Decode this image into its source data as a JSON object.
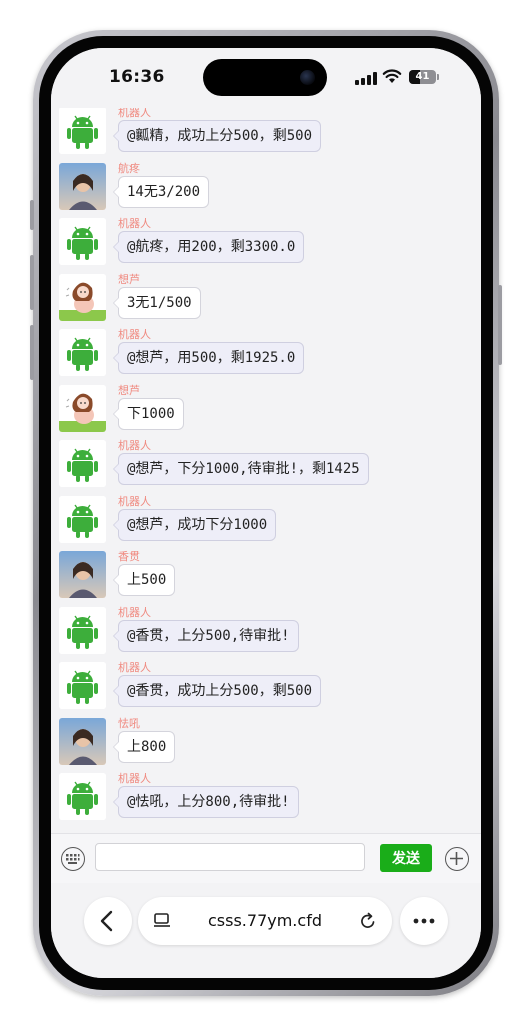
{
  "status_bar": {
    "time": "16:36",
    "battery": "41",
    "battery_level": 0.41
  },
  "chat": {
    "messages": [
      {
        "sender": "机器人",
        "avatar": "android-icon",
        "text": "@瓤精，成功上分500，剩500",
        "bot": true
      },
      {
        "sender": "航疼",
        "avatar": "photo-avatar",
        "text": "14无3/200",
        "bot": false
      },
      {
        "sender": "机器人",
        "avatar": "android-icon",
        "text": "@航疼，用200，剩3300.0",
        "bot": true
      },
      {
        "sender": "想芦",
        "avatar": "cartoon-girl-avatar",
        "text": "3无1/500",
        "bot": false
      },
      {
        "sender": "机器人",
        "avatar": "android-icon",
        "text": "@想芦，用500，剩1925.0",
        "bot": true
      },
      {
        "sender": "想芦",
        "avatar": "cartoon-girl-avatar",
        "text": "下1000",
        "bot": false
      },
      {
        "sender": "机器人",
        "avatar": "android-icon",
        "text": "@想芦，下分1000,待审批!，剩1425",
        "bot": true
      },
      {
        "sender": "机器人",
        "avatar": "android-icon",
        "text": "@想芦，成功下分1000",
        "bot": true
      },
      {
        "sender": "香贯",
        "avatar": "photo-avatar",
        "text": "上500",
        "bot": false
      },
      {
        "sender": "机器人",
        "avatar": "android-icon",
        "text": "@香贯，上分500,待审批!",
        "bot": true
      },
      {
        "sender": "机器人",
        "avatar": "android-icon",
        "text": "@香贯，成功上分500，剩500",
        "bot": true
      },
      {
        "sender": "怯吼",
        "avatar": "photo-avatar",
        "text": "上800",
        "bot": false
      },
      {
        "sender": "机器人",
        "avatar": "android-icon",
        "text": "@怯吼，上分800,待审批!",
        "bot": true
      }
    ]
  },
  "input_bar": {
    "input_value": "",
    "send_label": "发送"
  },
  "browser": {
    "url": "csss.77ym.cfd"
  },
  "colors": {
    "send_green": "#1aad19",
    "sender_pink": "#f08a80",
    "android_green": "#3dae3b"
  }
}
